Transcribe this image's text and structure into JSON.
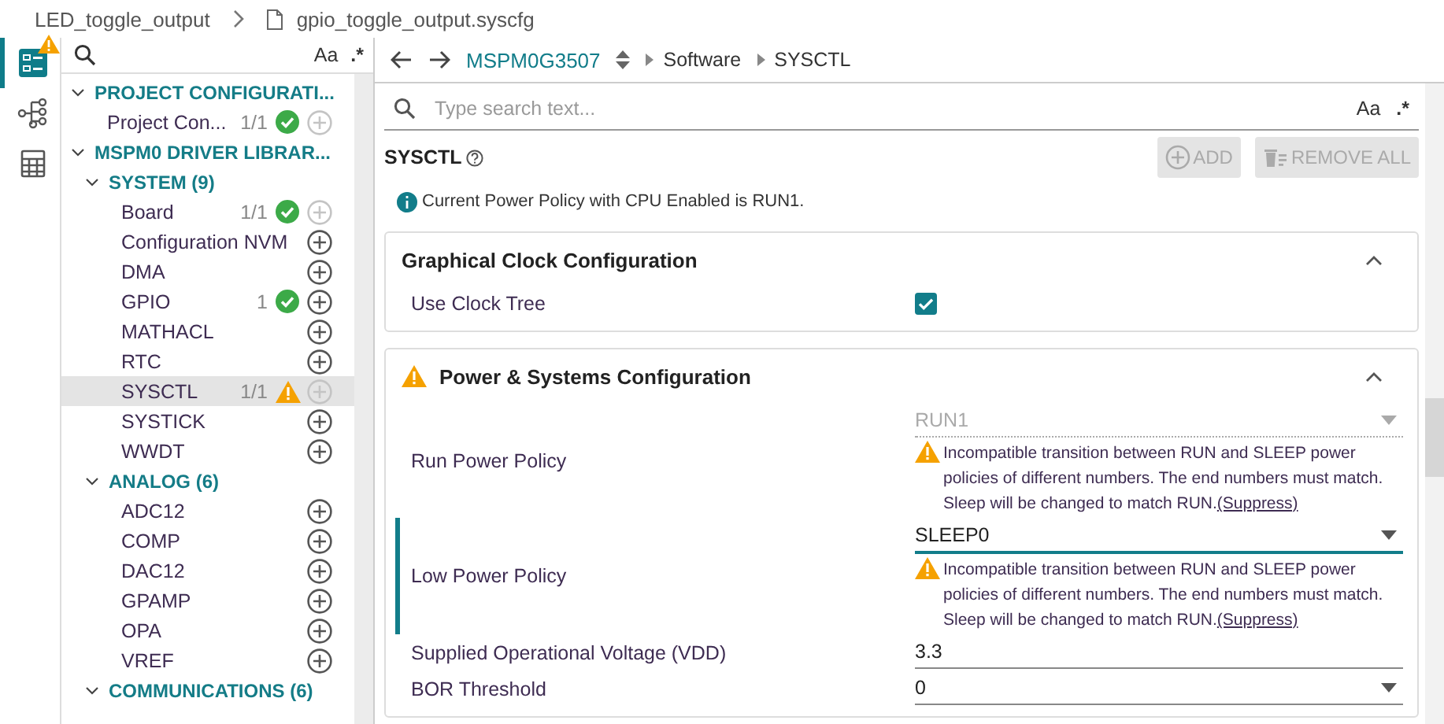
{
  "breadcrumb": {
    "project": "LED_toggle_output",
    "file": "gpio_toggle_output.syscfg"
  },
  "rail": [
    {
      "kind": "config",
      "selected": true,
      "warning": true
    },
    {
      "kind": "network",
      "selected": false,
      "warning": false
    },
    {
      "kind": "calculator",
      "selected": false,
      "warning": false
    }
  ],
  "tree_toolbar": {
    "case_toggle": "Aa",
    "regex_toggle": ".*"
  },
  "tree": [
    {
      "label": "PROJECT CONFIGURATI...",
      "expanded": true,
      "children": [
        {
          "label": "Project Con...",
          "count": "1/1",
          "valid": true,
          "warning": false,
          "add_enabled": false,
          "selected": false
        }
      ]
    },
    {
      "label": "MSPM0 DRIVER LIBRAR...",
      "expanded": true,
      "children": [
        {
          "label": "SYSTEM (9)",
          "expanded": true,
          "children": [
            {
              "label": "Board",
              "count": "1/1",
              "valid": true,
              "warning": false,
              "add_enabled": false,
              "selected": false
            },
            {
              "label": "Configuration NVM",
              "valid": false,
              "warning": false,
              "add_enabled": true,
              "selected": false
            },
            {
              "label": "DMA",
              "valid": false,
              "warning": false,
              "add_enabled": true,
              "selected": false
            },
            {
              "label": "GPIO",
              "count": "1",
              "valid": true,
              "warning": false,
              "add_enabled": true,
              "selected": false
            },
            {
              "label": "MATHACL",
              "valid": false,
              "warning": false,
              "add_enabled": true,
              "selected": false
            },
            {
              "label": "RTC",
              "valid": false,
              "warning": false,
              "add_enabled": true,
              "selected": false
            },
            {
              "label": "SYSCTL",
              "count": "1/1",
              "valid": false,
              "warning": true,
              "add_enabled": false,
              "selected": true
            },
            {
              "label": "SYSTICK",
              "valid": false,
              "warning": false,
              "add_enabled": true,
              "selected": false
            },
            {
              "label": "WWDT",
              "valid": false,
              "warning": false,
              "add_enabled": true,
              "selected": false
            }
          ]
        },
        {
          "label": "ANALOG (6)",
          "expanded": true,
          "children": [
            {
              "label": "ADC12",
              "valid": false,
              "warning": false,
              "add_enabled": true,
              "selected": false
            },
            {
              "label": "COMP",
              "valid": false,
              "warning": false,
              "add_enabled": true,
              "selected": false
            },
            {
              "label": "DAC12",
              "valid": false,
              "warning": false,
              "add_enabled": true,
              "selected": false
            },
            {
              "label": "GPAMP",
              "valid": false,
              "warning": false,
              "add_enabled": true,
              "selected": false
            },
            {
              "label": "OPA",
              "valid": false,
              "warning": false,
              "add_enabled": true,
              "selected": false
            },
            {
              "label": "VREF",
              "valid": false,
              "warning": false,
              "add_enabled": true,
              "selected": false
            }
          ]
        },
        {
          "label": "COMMUNICATIONS (6)",
          "expanded": true
        }
      ]
    }
  ],
  "nav": {
    "device": "MSPM0G3507",
    "path": [
      "Software",
      "SYSCTL"
    ]
  },
  "search": {
    "placeholder": "Type search text...",
    "case_toggle": "Aa",
    "regex_toggle": ".*"
  },
  "heading": "SYSCTL",
  "buttons": [
    {
      "kind": "add",
      "label": "ADD",
      "disabled": true
    },
    {
      "kind": "remove",
      "label": "REMOVE ALL",
      "disabled": true
    }
  ],
  "info": "Current Power Policy with CPU Enabled is RUN1.",
  "sections": [
    {
      "title": "Graphical Clock Configuration",
      "warning": false,
      "expanded": true,
      "rows": [
        {
          "kind": "checkbox",
          "label": "Use Clock Tree",
          "checked": true
        }
      ]
    },
    {
      "title": "Power & Systems Configuration",
      "warning": true,
      "expanded": true,
      "rows": [
        {
          "kind": "select",
          "label": "Run Power Policy",
          "value": "RUN1",
          "disabled": true,
          "focused": false,
          "warning": "Incompatible transition between RUN and SLEEP power policies of different numbers. The end numbers must match. Sleep will be changed to match RUN.",
          "link": "(Suppress)"
        },
        {
          "kind": "select",
          "label": "Low Power Policy",
          "value": "SLEEP0",
          "disabled": false,
          "focused": true,
          "warning": "Incompatible transition between RUN and SLEEP power policies of different numbers. The end numbers must match. Sleep will be changed to match RUN.",
          "link": "(Suppress)"
        },
        {
          "kind": "text",
          "label": "Supplied Operational Voltage (VDD)",
          "value": "3.3",
          "disabled": false,
          "focused": false
        },
        {
          "kind": "select",
          "label": "BOR Threshold",
          "value": "0",
          "disabled": false,
          "focused": false
        }
      ]
    }
  ]
}
